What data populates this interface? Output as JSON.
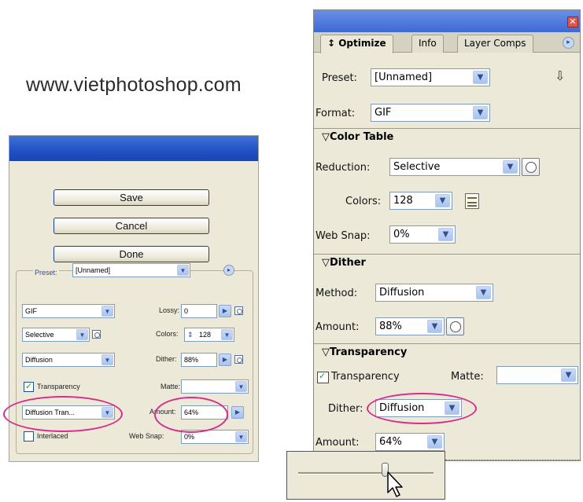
{
  "site_url": "www.vietphotoshop.com",
  "left_dialog": {
    "buttons": {
      "save": "Save",
      "cancel": "Cancel",
      "done": "Done"
    },
    "preset_label": "Preset:",
    "preset_value": "[Unnamed]",
    "format_value": "GIF",
    "lossy_label": "Lossy:",
    "lossy_value": "0",
    "reduction_value": "Selective",
    "colors_label": "Colors:",
    "colors_value": "128",
    "dither_method_value": "Diffusion",
    "dither_label": "Dither:",
    "dither_value": "88%",
    "transparency_label": "Transparency",
    "matte_label": "Matte:",
    "trans_dither_value": "Diffusion Tran...",
    "amount_label": "Amount:",
    "amount_value": "64%",
    "interlaced_label": "Interlaced",
    "web_snap_label": "Web Snap:",
    "web_snap_value": "0%"
  },
  "right_panel": {
    "tabs": [
      "Optimize",
      "Info",
      "Layer Comps"
    ],
    "tab_prefix": "↕ ",
    "preset_label": "Preset:",
    "preset_value": "[Unnamed]",
    "format_label": "Format:",
    "format_value": "GIF",
    "color_table_title": "Color Table",
    "reduction_label": "Reduction:",
    "reduction_value": "Selective",
    "colors_label": "Colors:",
    "colors_value": "128",
    "web_snap_label": "Web Snap:",
    "web_snap_value": "0%",
    "dither_title": "Dither",
    "method_label": "Method:",
    "method_value": "Diffusion",
    "amount_label": "Amount:",
    "amount_value": "88%",
    "transparency_title": "Transparency",
    "transparency_label": "Transparency",
    "matte_label": "Matte:",
    "matte_value": "",
    "trans_dither_label": "Dither:",
    "trans_dither_value": "Diffusion",
    "trans_amount_label": "Amount:",
    "trans_amount_value": "64%"
  },
  "slider": {
    "value_fraction": 0.64
  },
  "colors": {
    "highlight": "#d82c8c",
    "title_blue": "#2250c4",
    "check_green": "#21a121"
  },
  "icons": [
    "close-icon",
    "panel-menu-icon",
    "chevron-down-icon",
    "optimize-menu-icon",
    "color-table-icon",
    "mouse-pointer-icon"
  ]
}
